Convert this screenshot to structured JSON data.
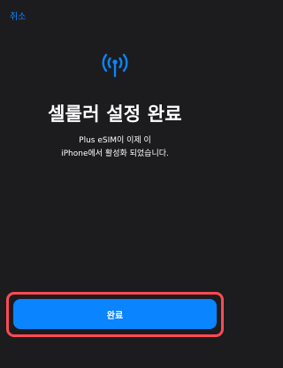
{
  "nav": {
    "cancel_label": "취소"
  },
  "icon": {
    "name": "cellular-signal-icon",
    "color": "#0a84ff"
  },
  "main": {
    "title": "셀룰러 설정 완료",
    "description_line1": "Plus eSIM이 이제 이",
    "description_line2": "iPhone에서 활성화 되었습니다."
  },
  "footer": {
    "done_label": "완료"
  },
  "colors": {
    "accent": "#0a84ff",
    "background": "#1c1c1e",
    "highlight": "#ff4a55"
  }
}
